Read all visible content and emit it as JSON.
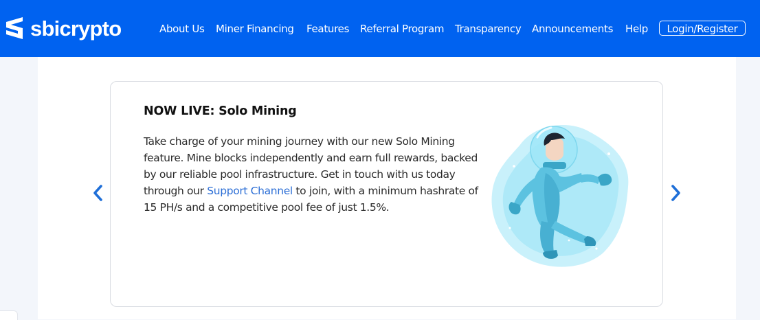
{
  "header": {
    "brand": "sbicrypto",
    "nav": [
      {
        "label": "About Us",
        "id": "about-us"
      },
      {
        "label": "Miner Financing",
        "id": "miner-financing"
      },
      {
        "label": "Features",
        "id": "features"
      },
      {
        "label": "Referral Program",
        "id": "referral-program"
      },
      {
        "label": "Transparency",
        "id": "transparency"
      },
      {
        "label": "Announcements",
        "id": "announcements"
      },
      {
        "label": "Help",
        "id": "help"
      }
    ],
    "login_label": "Login/Register"
  },
  "slide": {
    "title": "NOW LIVE: Solo Mining",
    "body_before_link": "Take charge of your mining journey with our new Solo Mining feature. Mine blocks independently and earn full rewards, backed by our reliable pool infrastructure. Get in touch with us today through our ",
    "link_text": "Support Channel",
    "body_after_link": " to join, with a minimum hashrate of 15 PH/s and a competitive pool fee of just 1.5%.",
    "illustration": "astronaut-in-bubble"
  },
  "icons": {
    "prev": "chevron-left-icon",
    "next": "chevron-right-icon"
  },
  "colors": {
    "brand_blue": "#0062f0",
    "link_blue": "#2d6fd6",
    "arrow_blue": "#1f6fd8",
    "card_border": "#d9dce2"
  }
}
